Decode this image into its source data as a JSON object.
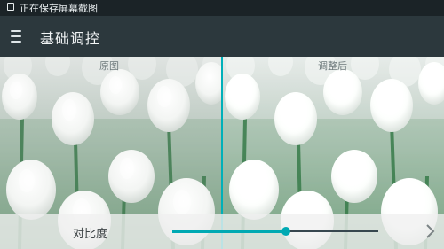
{
  "status": {
    "text": "正在保存屏幕截图"
  },
  "appbar": {
    "title": "基础调控",
    "menu_icon": "menu-icon"
  },
  "compare": {
    "original_label": "原图",
    "adjusted_label": "调整后"
  },
  "control": {
    "label": "对比度",
    "value": 0.55,
    "accent": "#00a9b3"
  },
  "icons": {
    "next": "chevron-right-icon",
    "photo": "tulip-photo"
  }
}
